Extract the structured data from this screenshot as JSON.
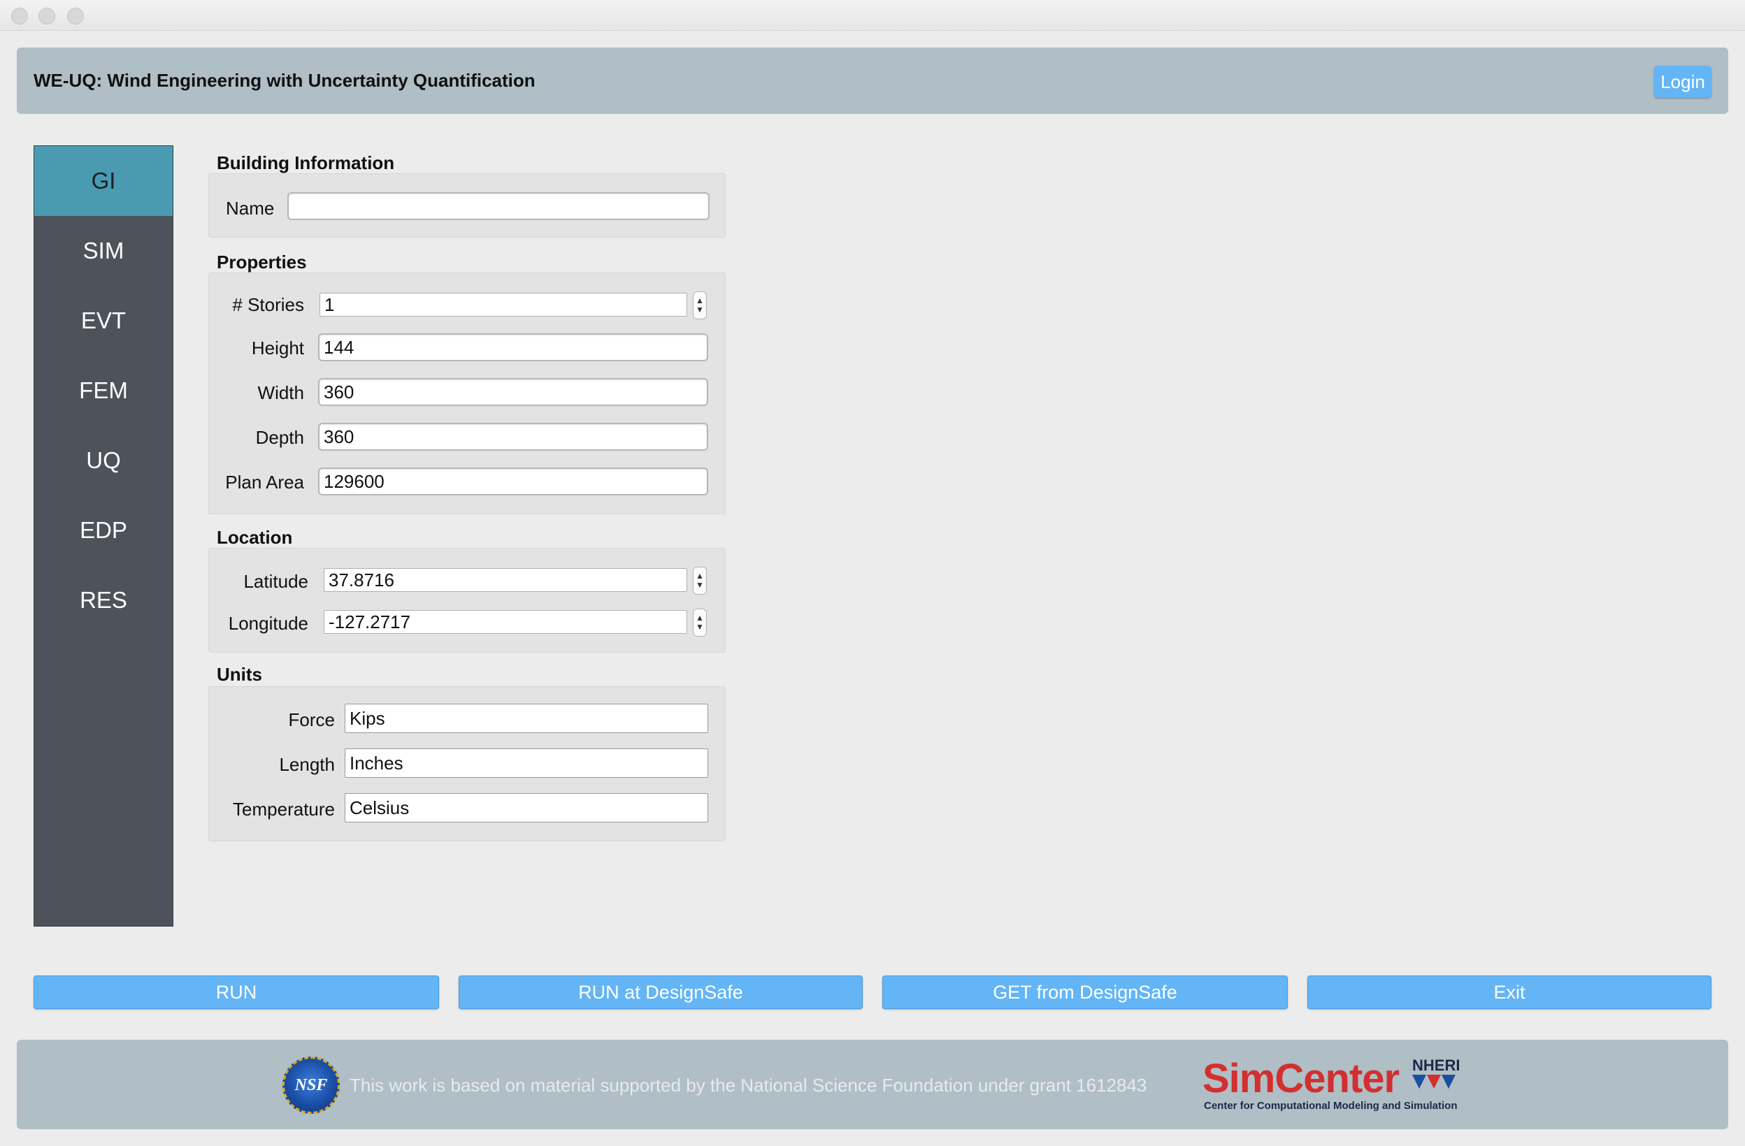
{
  "header": {
    "title": "WE-UQ: Wind Engineering with Uncertainty Quantification",
    "login_label": "Login"
  },
  "sidebar": {
    "items": [
      {
        "label": "GI",
        "active": true
      },
      {
        "label": "SIM"
      },
      {
        "label": "EVT"
      },
      {
        "label": "FEM"
      },
      {
        "label": "UQ"
      },
      {
        "label": "EDP"
      },
      {
        "label": "RES"
      }
    ]
  },
  "building_info": {
    "title": "Building Information",
    "name_label": "Name",
    "name_value": ""
  },
  "properties": {
    "title": "Properties",
    "stories_label": "# Stories",
    "stories_value": "1",
    "height_label": "Height",
    "height_value": "144",
    "width_label": "Width",
    "width_value": "360",
    "depth_label": "Depth",
    "depth_value": "360",
    "plan_area_label": "Plan Area",
    "plan_area_value": "129600"
  },
  "location": {
    "title": "Location",
    "latitude_label": "Latitude",
    "latitude_value": "37.8716",
    "longitude_label": "Longitude",
    "longitude_value": "-127.2717"
  },
  "units": {
    "title": "Units",
    "force_label": "Force",
    "force_value": "Kips",
    "length_label": "Length",
    "length_value": "Inches",
    "temperature_label": "Temperature",
    "temperature_value": "Celsius"
  },
  "actions": {
    "run": "RUN",
    "run_designsafe": "RUN at DesignSafe",
    "get_designsafe": "GET from DesignSafe",
    "exit": "Exit"
  },
  "footer": {
    "acknowledgement": "This work is based on material supported by the National Science Foundation under grant 1612843",
    "nsf_logo_text": "NSF",
    "simcenter_wordmark": "SimCenter",
    "nheri_text": "NHERI",
    "simcenter_subtitle": "Center for Computational Modeling and Simulation"
  },
  "colors": {
    "header_bg": "#b0bec5",
    "sidebar_bg": "#4e525a",
    "sidebar_active": "#4a9bb2",
    "button_bg": "#64b5f6",
    "simcenter_red": "#d32f2f"
  }
}
